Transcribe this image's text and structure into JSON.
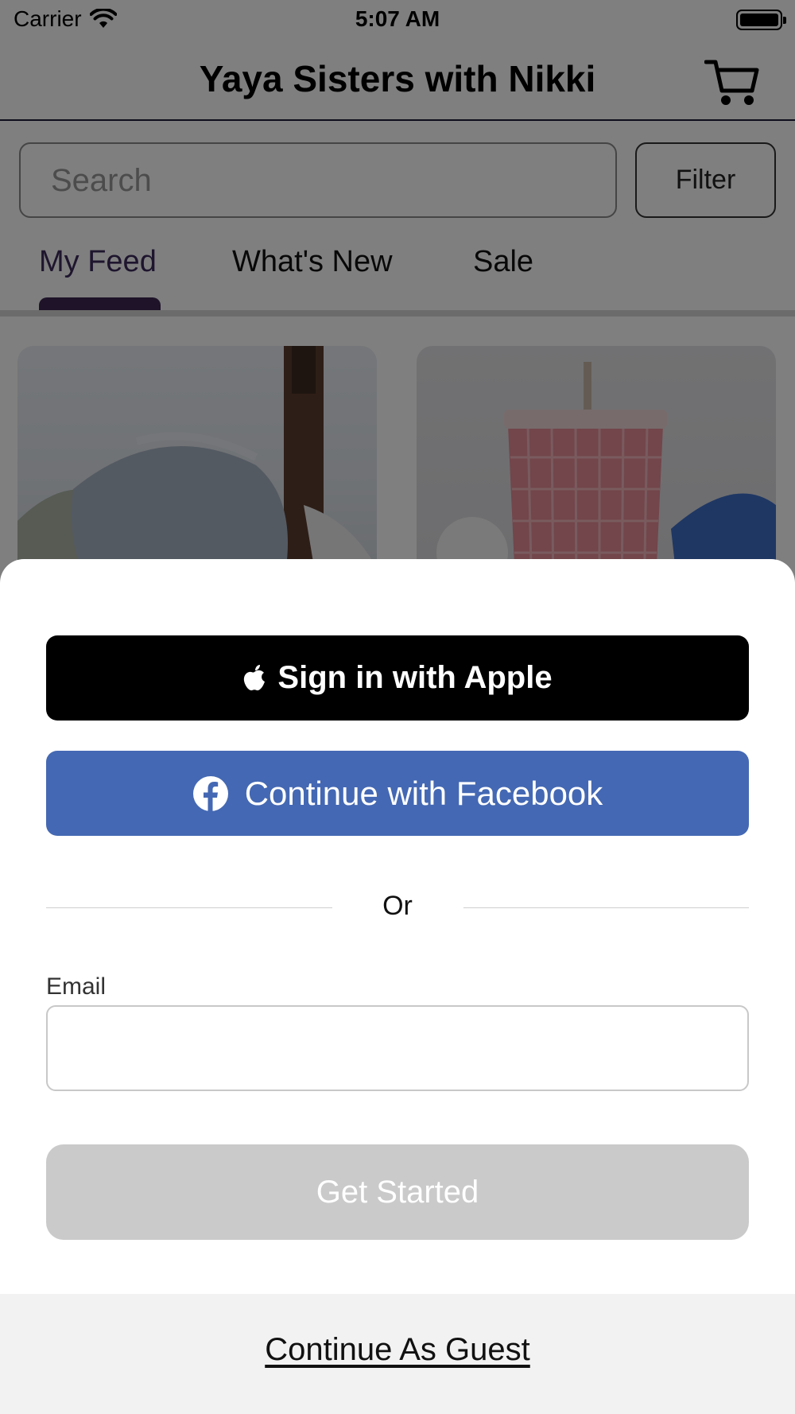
{
  "status_bar": {
    "carrier": "Carrier",
    "time": "5:07 AM",
    "icons": [
      "wifi-icon",
      "battery-icon"
    ]
  },
  "nav": {
    "title": "Yaya Sisters with Nikki",
    "cart_icon": "cart-icon"
  },
  "search": {
    "placeholder": "Search"
  },
  "filter": {
    "label": "Filter"
  },
  "tabs": [
    {
      "label": "My Feed",
      "active": true
    },
    {
      "label": "What's New",
      "active": false
    },
    {
      "label": "Sale",
      "active": false
    }
  ],
  "sheet": {
    "apple_label": "Sign in with Apple",
    "facebook_label": "Continue with Facebook",
    "or_label": "Or",
    "email_label": "Email",
    "email_value": "",
    "get_started_label": "Get Started",
    "guest_label": "Continue As Guest"
  },
  "colors": {
    "accent": "#3d2752",
    "facebook": "#4468b3",
    "apple": "#000000",
    "disabled_button": "#cacaca"
  }
}
